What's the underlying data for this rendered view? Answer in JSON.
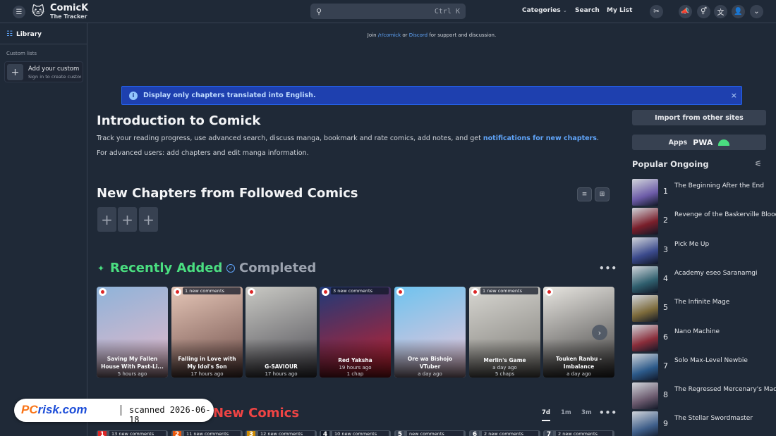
{
  "header": {
    "brand_title": "ComicK",
    "brand_subtitle": "The Tracker",
    "search_shortcut": "Ctrl K",
    "nav": {
      "categories": "Categories",
      "categories_caret": "⌄",
      "search": "Search",
      "my_list": "My List"
    }
  },
  "sidebar": {
    "library": "Library",
    "custom_lists": "Custom lists",
    "add_title": "Add your custom list",
    "add_sub": "Sign in to create custom lists"
  },
  "join": {
    "pre": "Join",
    "reddit": "/r/comick",
    "or": "or",
    "discord": "Discord",
    "post": "for support and discussion."
  },
  "alert": {
    "text": "Display only chapters translated into English.",
    "icon": "i",
    "close": "×"
  },
  "intro": {
    "title": "Introduction to Comick",
    "p1_text": "Track your reading progress, use advanced search, discuss manga, bookmark and rate comics, add notes, and get ",
    "p1_link": "notifications for new chapters",
    "p1_end": ".",
    "p2": "For advanced users: add chapters and edit manga information."
  },
  "followed": {
    "title": "New Chapters from Followed Comics",
    "slot": "+"
  },
  "recent": {
    "title_recent": "Recently Added",
    "sep": "/",
    "title_completed": "Completed",
    "cards": [
      {
        "badge": "",
        "title_l1": "Saving My Fallen",
        "title_l2": "House With Past-Li...",
        "sub": "5 hours ago",
        "sub2": "",
        "c1": "#8fb3d9",
        "c2": "#e8b9c9"
      },
      {
        "badge": "1 new comments",
        "title_l1": "Falling in Love with",
        "title_l2": "My Idol's Son",
        "sub": "17 hours ago",
        "sub2": "",
        "c1": "#e6c7b8",
        "c2": "#6b4a46"
      },
      {
        "badge": "",
        "title_l1": "",
        "title_l2": "G-SAVIOUR",
        "sub": "17 hours ago",
        "sub2": "",
        "c1": "#c9c9c4",
        "c2": "#4b4a52"
      },
      {
        "badge": "3 new comments",
        "title_l1": "",
        "title_l2": "Red Yaksha",
        "sub": "1 chap",
        "sub2": "19 hours ago",
        "c1": "#1f3a78",
        "c2": "#c91f2b"
      },
      {
        "badge": "",
        "title_l1": "Ore wa Bishojo",
        "title_l2": "VTuber",
        "sub": "a day ago",
        "sub2": "",
        "c1": "#6ec3ef",
        "c2": "#f2c6d8"
      },
      {
        "badge": "1 new comments",
        "title_l1": "",
        "title_l2": "Merlin's Game",
        "sub": "5 chaps",
        "sub2": "a day ago",
        "c1": "#d8d7d2",
        "c2": "#7a7873"
      },
      {
        "badge": "",
        "title_l1": "Touken Ranbu -",
        "title_l2": "Imbalance",
        "sub": "a day ago",
        "sub2": "",
        "c1": "#e7e5e0",
        "c2": "#3b3a3a"
      }
    ]
  },
  "watermark": {
    "logo_a": "PC",
    "logo_b": "risk.com",
    "scanned": "scanned 2026-06-18"
  },
  "new_comics": {
    "title": "New Comics",
    "tabs": [
      "7d",
      "1m",
      "3m"
    ],
    "cards": [
      {
        "rank": "1",
        "badge": "13 new comments",
        "color": "#dc2626"
      },
      {
        "rank": "2",
        "badge": "11 new comments",
        "color": "#ea580c"
      },
      {
        "rank": "3",
        "badge": "12 new comments",
        "color": "#ca8a04"
      },
      {
        "rank": "4",
        "badge": "10 new comments",
        "color": "#111827"
      },
      {
        "rank": "5",
        "badge": "new comments",
        "color": "#374151"
      },
      {
        "rank": "6",
        "badge": "2 new comments",
        "color": "#374151"
      },
      {
        "rank": "7",
        "badge": "2 new comments",
        "color": "#374151"
      }
    ]
  },
  "right": {
    "import": "Import from other sites",
    "apps": "Apps",
    "pwa": "PWA",
    "popular_title": "Popular Ongoing",
    "popular": [
      {
        "rank": "1",
        "name": "The Beginning After the End",
        "c": "#6d5ca8"
      },
      {
        "rank": "2",
        "name": "Revenge of the Baskerville Bloodhound",
        "c": "#7a1f2b"
      },
      {
        "rank": "3",
        "name": "Pick Me Up",
        "c": "#3b4a8c"
      },
      {
        "rank": "4",
        "name": "Academy eseo Saranamgi",
        "c": "#2f5f6e"
      },
      {
        "rank": "5",
        "name": "The Infinite Mage",
        "c": "#7c6a3a"
      },
      {
        "rank": "6",
        "name": "Nano Machine",
        "c": "#8a2d3a"
      },
      {
        "rank": "7",
        "name": "Solo Max-Level Newbie",
        "c": "#2c5a8a"
      },
      {
        "rank": "8",
        "name": "The Regressed Mercenary's Machinations",
        "c": "#6b5a6e"
      },
      {
        "rank": "9",
        "name": "The Stellar Swordmaster",
        "c": "#3f5f8a"
      }
    ]
  },
  "icons": {
    "menu": "☰",
    "logo": "🐱",
    "search": "⚲",
    "tools": "✂",
    "megaphone": "📣",
    "gender": "⚥",
    "translate": "文",
    "user": "👤",
    "chevron": "⌄",
    "library": "☷",
    "plus": "+",
    "list_view": "≡",
    "grid_view": "⊞",
    "sparkle": "✦",
    "check": "✓",
    "dots": "•••",
    "next": "›",
    "filter": "⚟",
    "close": "×"
  },
  "colors": {
    "accent": "#60a5fa",
    "recent": "#4ade80",
    "new_comics": "#ef4444",
    "background": "#1f2937"
  }
}
